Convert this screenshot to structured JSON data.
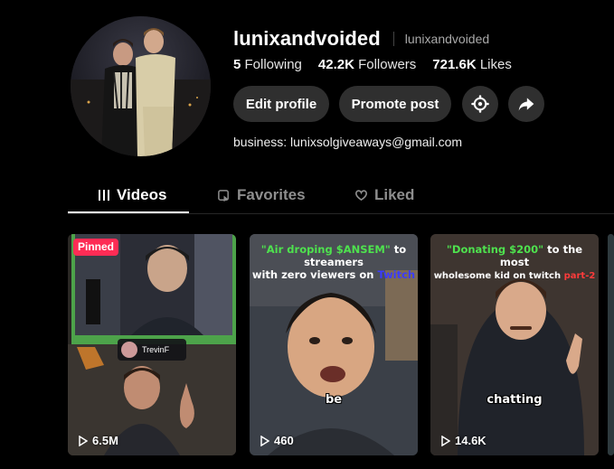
{
  "profile": {
    "username": "lunixandvoided",
    "nickname": "lunixandvoided",
    "stats": [
      {
        "value": "5",
        "label": "Following"
      },
      {
        "value": "42.2K",
        "label": "Followers"
      },
      {
        "value": "721.6K",
        "label": "Likes"
      }
    ],
    "bio": "business: lunixsolgiveaways@gmail.com"
  },
  "actions": {
    "edit_label": "Edit profile",
    "promote_label": "Promote post",
    "settings_icon": "gear-icon",
    "share_icon": "share-arrow-icon"
  },
  "tabs": [
    {
      "label": "Videos",
      "icon": "grid-icon",
      "active": true
    },
    {
      "label": "Favorites",
      "icon": "bookmark-icon",
      "active": false
    },
    {
      "label": "Liked",
      "icon": "heart-icon",
      "active": false
    }
  ],
  "videos": [
    {
      "views": "6.5M",
      "pinned_label": "Pinned",
      "streamer_tag": "TrevinF",
      "subtitle": ""
    },
    {
      "views": "460",
      "caption_parts": [
        "\"Air droping $ANSEM\"",
        " to streamers",
        "with zero viewers on ",
        "Twitch"
      ],
      "subtitle": "be"
    },
    {
      "views": "14.6K",
      "caption_parts": [
        "\"Donating $200\"",
        " to the most",
        "wholesome kid on twitch ",
        "part-2"
      ],
      "subtitle": "chatting"
    }
  ],
  "colors": {
    "accent": "#fe2c55",
    "button_bg": "#2f2f2f",
    "bg": "#000000"
  }
}
